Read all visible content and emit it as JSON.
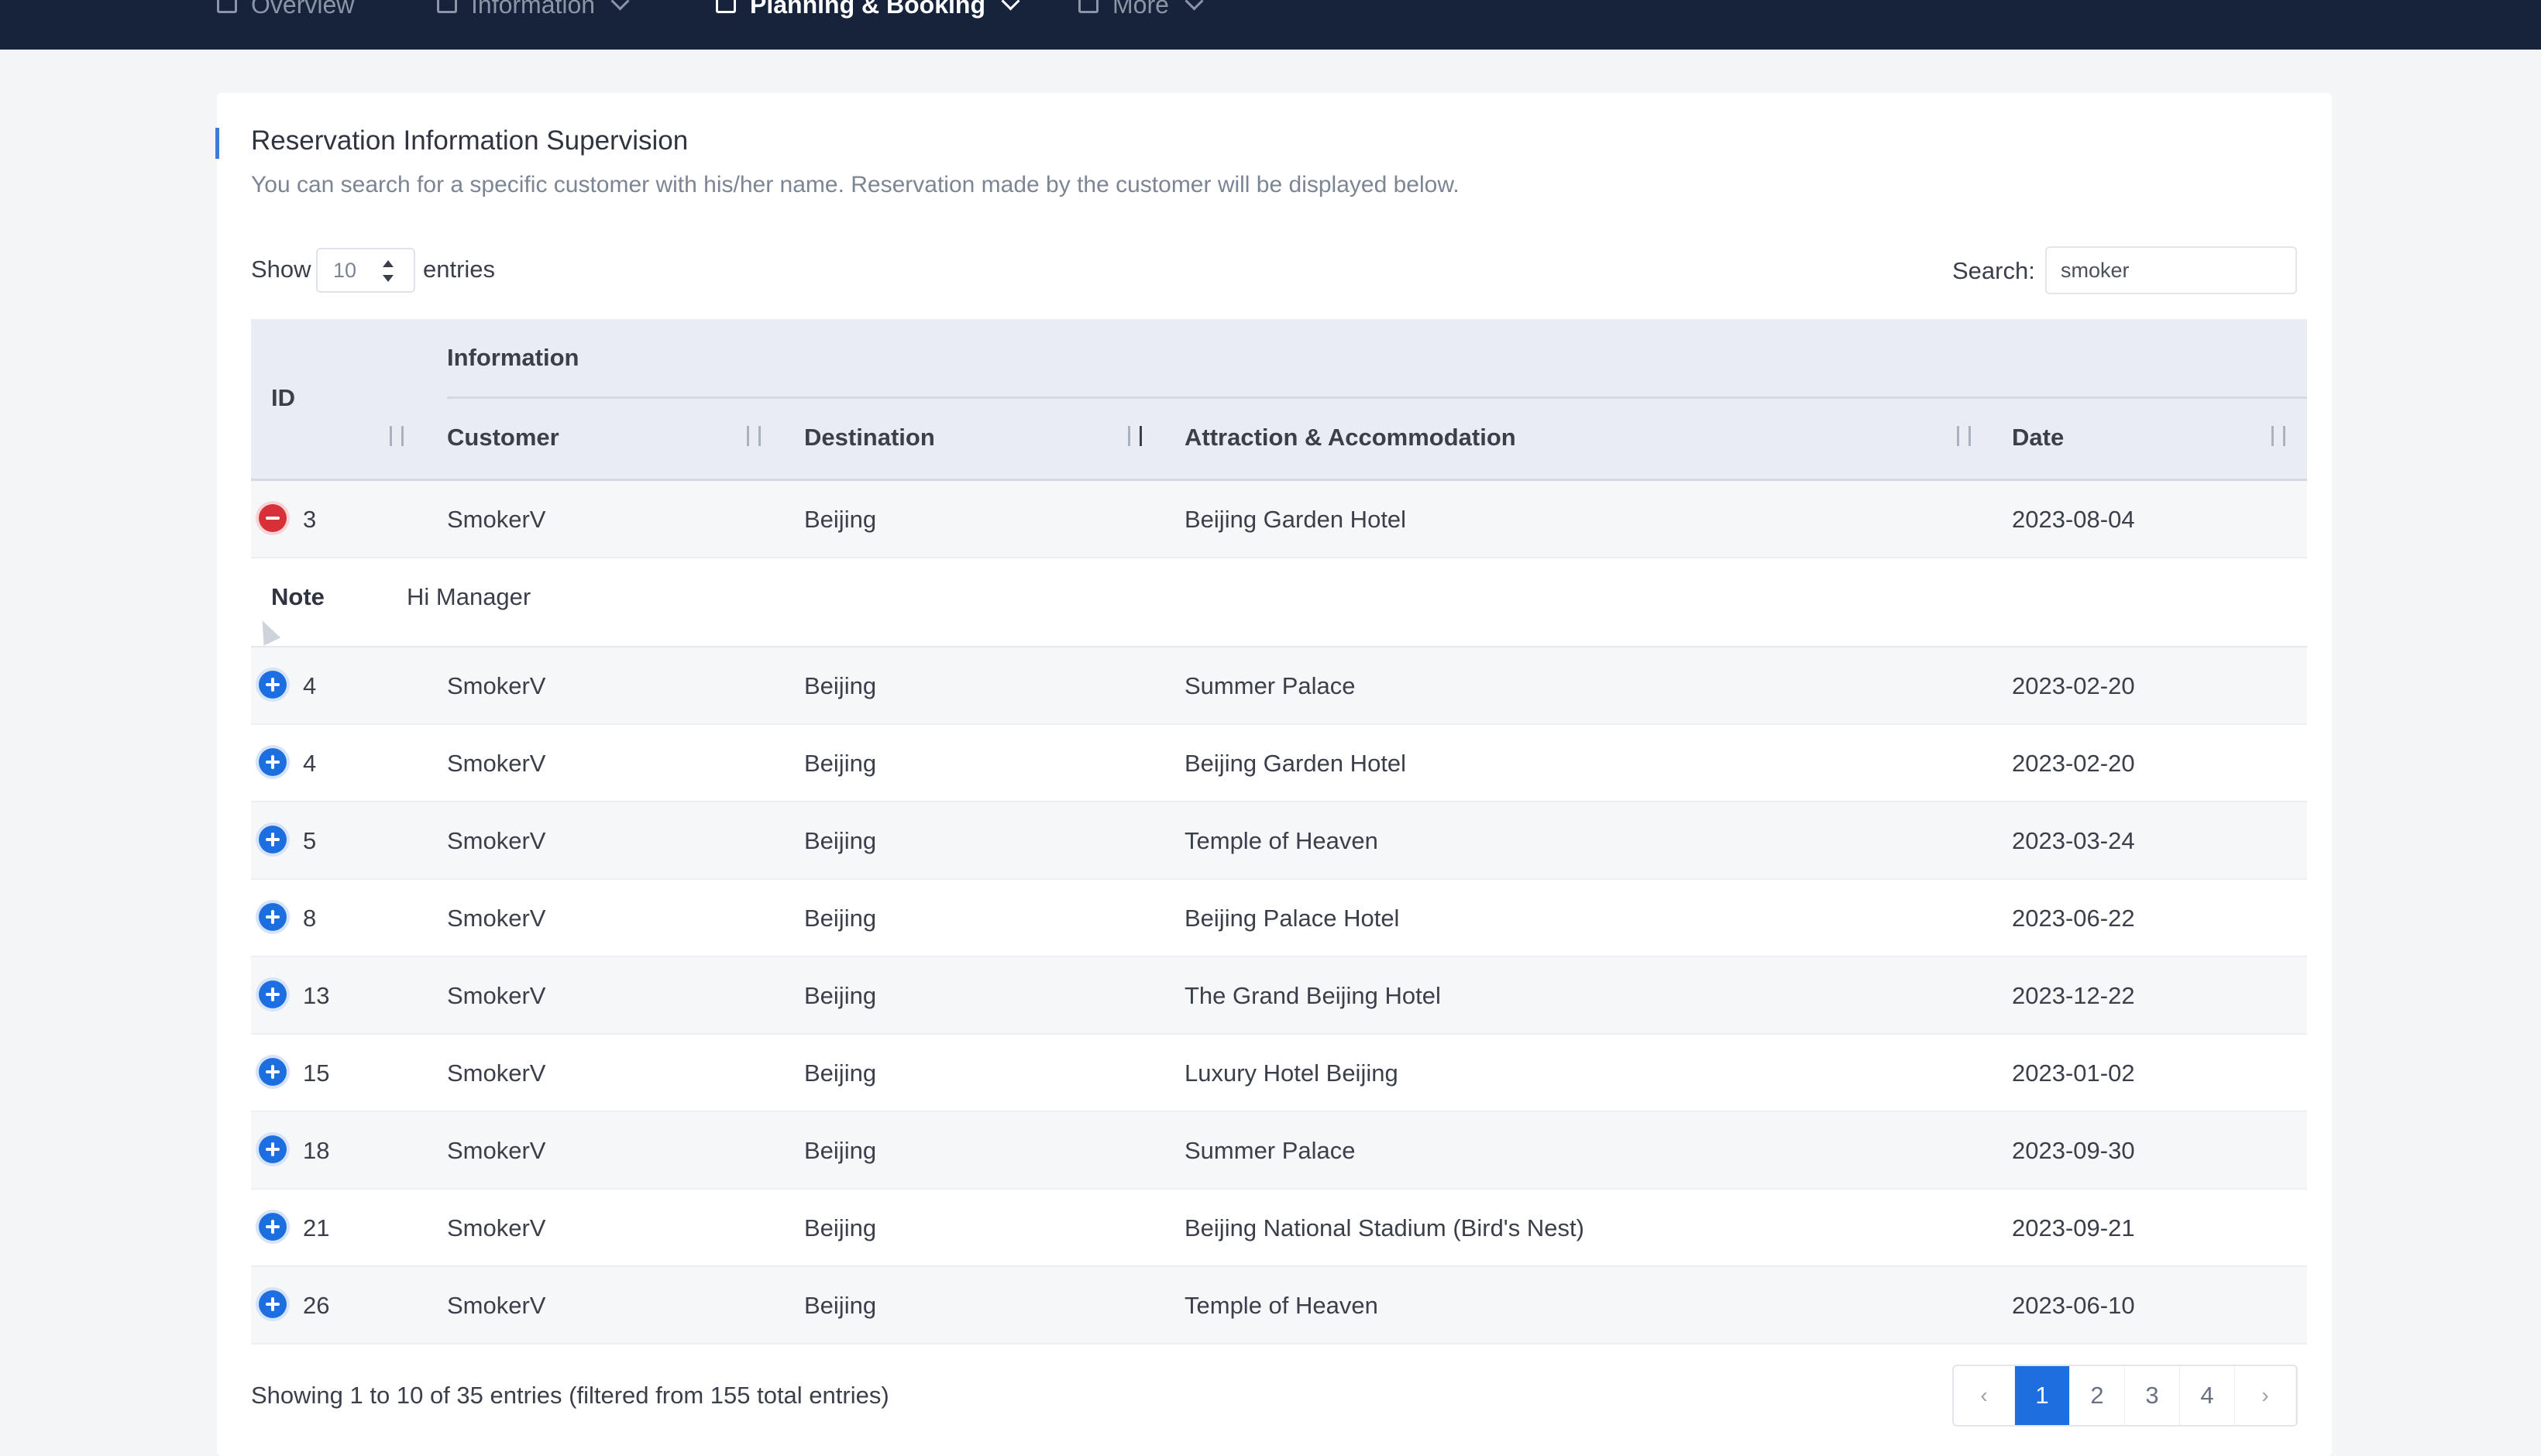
{
  "nav": {
    "items": [
      {
        "label": "Overview",
        "icon": "dashboard-icon",
        "active": false
      },
      {
        "label": "Information",
        "icon": "document-icon",
        "active": false
      },
      {
        "label": "Planning & Booking",
        "icon": "calendar-icon",
        "active": true
      },
      {
        "label": "More",
        "icon": "book-icon",
        "active": false
      }
    ]
  },
  "page": {
    "title": "Reservation Information Supervision",
    "subtitle": "You can search for a specific customer with his/her name. Reservation made by the customer will be displayed below."
  },
  "controls": {
    "show_label": "Show",
    "length_value": "10",
    "entries_label": "entries",
    "search_label": "Search:",
    "search_value": "smoker"
  },
  "table": {
    "group_header": "Information",
    "headers": {
      "id": "ID",
      "customer": "Customer",
      "destination": "Destination",
      "attraction": "Attraction & Accommodation",
      "date": "Date"
    },
    "rows": [
      {
        "id": "3",
        "customer": "SmokerV",
        "destination": "Beijing",
        "attraction": "Beijing Garden Hotel",
        "date": "2023-08-04",
        "expanded": true
      },
      {
        "id": "4",
        "customer": "SmokerV",
        "destination": "Beijing",
        "attraction": "Summer Palace",
        "date": "2023-02-20",
        "expanded": false
      },
      {
        "id": "4",
        "customer": "SmokerV",
        "destination": "Beijing",
        "attraction": "Beijing Garden Hotel",
        "date": "2023-02-20",
        "expanded": false
      },
      {
        "id": "5",
        "customer": "SmokerV",
        "destination": "Beijing",
        "attraction": "Temple of Heaven",
        "date": "2023-03-24",
        "expanded": false
      },
      {
        "id": "8",
        "customer": "SmokerV",
        "destination": "Beijing",
        "attraction": "Beijing Palace Hotel",
        "date": "2023-06-22",
        "expanded": false
      },
      {
        "id": "13",
        "customer": "SmokerV",
        "destination": "Beijing",
        "attraction": "The Grand Beijing Hotel",
        "date": "2023-12-22",
        "expanded": false
      },
      {
        "id": "15",
        "customer": "SmokerV",
        "destination": "Beijing",
        "attraction": "Luxury Hotel Beijing",
        "date": "2023-01-02",
        "expanded": false
      },
      {
        "id": "18",
        "customer": "SmokerV",
        "destination": "Beijing",
        "attraction": "Summer Palace",
        "date": "2023-09-30",
        "expanded": false
      },
      {
        "id": "21",
        "customer": "SmokerV",
        "destination": "Beijing",
        "attraction": "Beijing National Stadium (Bird's Nest)",
        "date": "2023-09-21",
        "expanded": false
      },
      {
        "id": "26",
        "customer": "SmokerV",
        "destination": "Beijing",
        "attraction": "Temple of Heaven",
        "date": "2023-06-10",
        "expanded": false
      }
    ],
    "note": {
      "label": "Note",
      "value": "Hi Manager"
    }
  },
  "footer": {
    "info": "Showing 1 to 10 of 35 entries (filtered from 155 total entries)",
    "pages": [
      "1",
      "2",
      "3",
      "4"
    ],
    "current_page": "1",
    "prev": "‹",
    "next": "›"
  },
  "colors": {
    "accent": "#1d6fe0",
    "collapse": "#d83038",
    "nav_bg": "#17233a"
  }
}
